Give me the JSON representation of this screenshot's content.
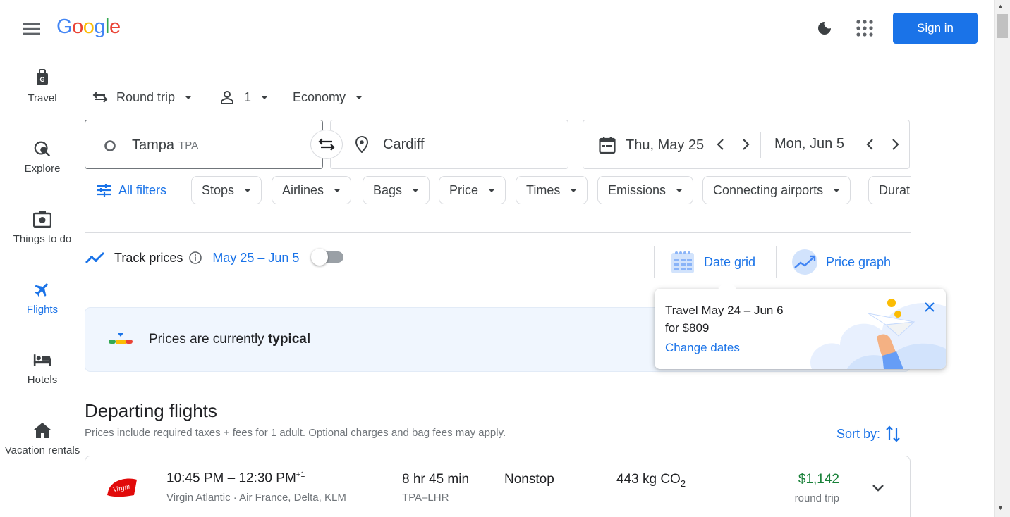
{
  "header": {
    "logo_letters": [
      "G",
      "o",
      "o",
      "g",
      "l",
      "e"
    ],
    "sign_in_label": "Sign in",
    "icons": [
      "menu-icon",
      "dark-theme-icon",
      "apps-grid-icon"
    ]
  },
  "nav": {
    "items": [
      {
        "label": "Travel",
        "icon": "luggage-icon"
      },
      {
        "label": "Explore",
        "icon": "explore-globe-icon"
      },
      {
        "label": "Things to do",
        "icon": "camera-icon"
      },
      {
        "label": "Flights",
        "icon": "airplane-icon",
        "active": true
      },
      {
        "label": "Hotels",
        "icon": "bed-icon"
      },
      {
        "label": "Vacation rentals",
        "icon": "house-icon"
      }
    ]
  },
  "search": {
    "trip_type": "Round trip",
    "passengers": "1",
    "cabin_class": "Economy",
    "origin_city": "Tampa",
    "origin_code": "TPA",
    "destination": "Cardiff",
    "depart_date": "Thu, May 25",
    "return_date": "Mon, Jun 5"
  },
  "filters": {
    "all_filters_label": "All filters",
    "chips": [
      "Stops",
      "Airlines",
      "Bags",
      "Price",
      "Times",
      "Emissions",
      "Connecting airports",
      "Durat"
    ]
  },
  "track": {
    "label": "Track prices",
    "range": "May 25 – Jun 5",
    "enabled": false
  },
  "tools": {
    "date_grid": "Date grid",
    "price_graph": "Price graph"
  },
  "insight": {
    "prefix": "Prices are currently ",
    "status": "typical",
    "colors": [
      "#34a853",
      "#fbbc04",
      "#ea4335"
    ]
  },
  "popup": {
    "text": "Travel May 24 – Jun 6 for $809",
    "link": "Change dates"
  },
  "departing": {
    "title": "Departing flights",
    "subtitle_prefix": "Prices include required taxes + fees for 1 adult. Optional charges and ",
    "subtitle_link": "bag fees",
    "subtitle_suffix": " may apply.",
    "sort_label": "Sort by:"
  },
  "flights": [
    {
      "times": "10:45 PM – 12:30 PM",
      "day_offset": "+1",
      "airlines": "Virgin Atlantic · Air France, Delta, KLM",
      "duration": "8 hr 45 min",
      "route": "TPA–LHR",
      "stops": "Nonstop",
      "co2_value": "443 kg CO",
      "co2_sub": "2",
      "price": "$1,142",
      "trip_kind": "round trip"
    }
  ]
}
